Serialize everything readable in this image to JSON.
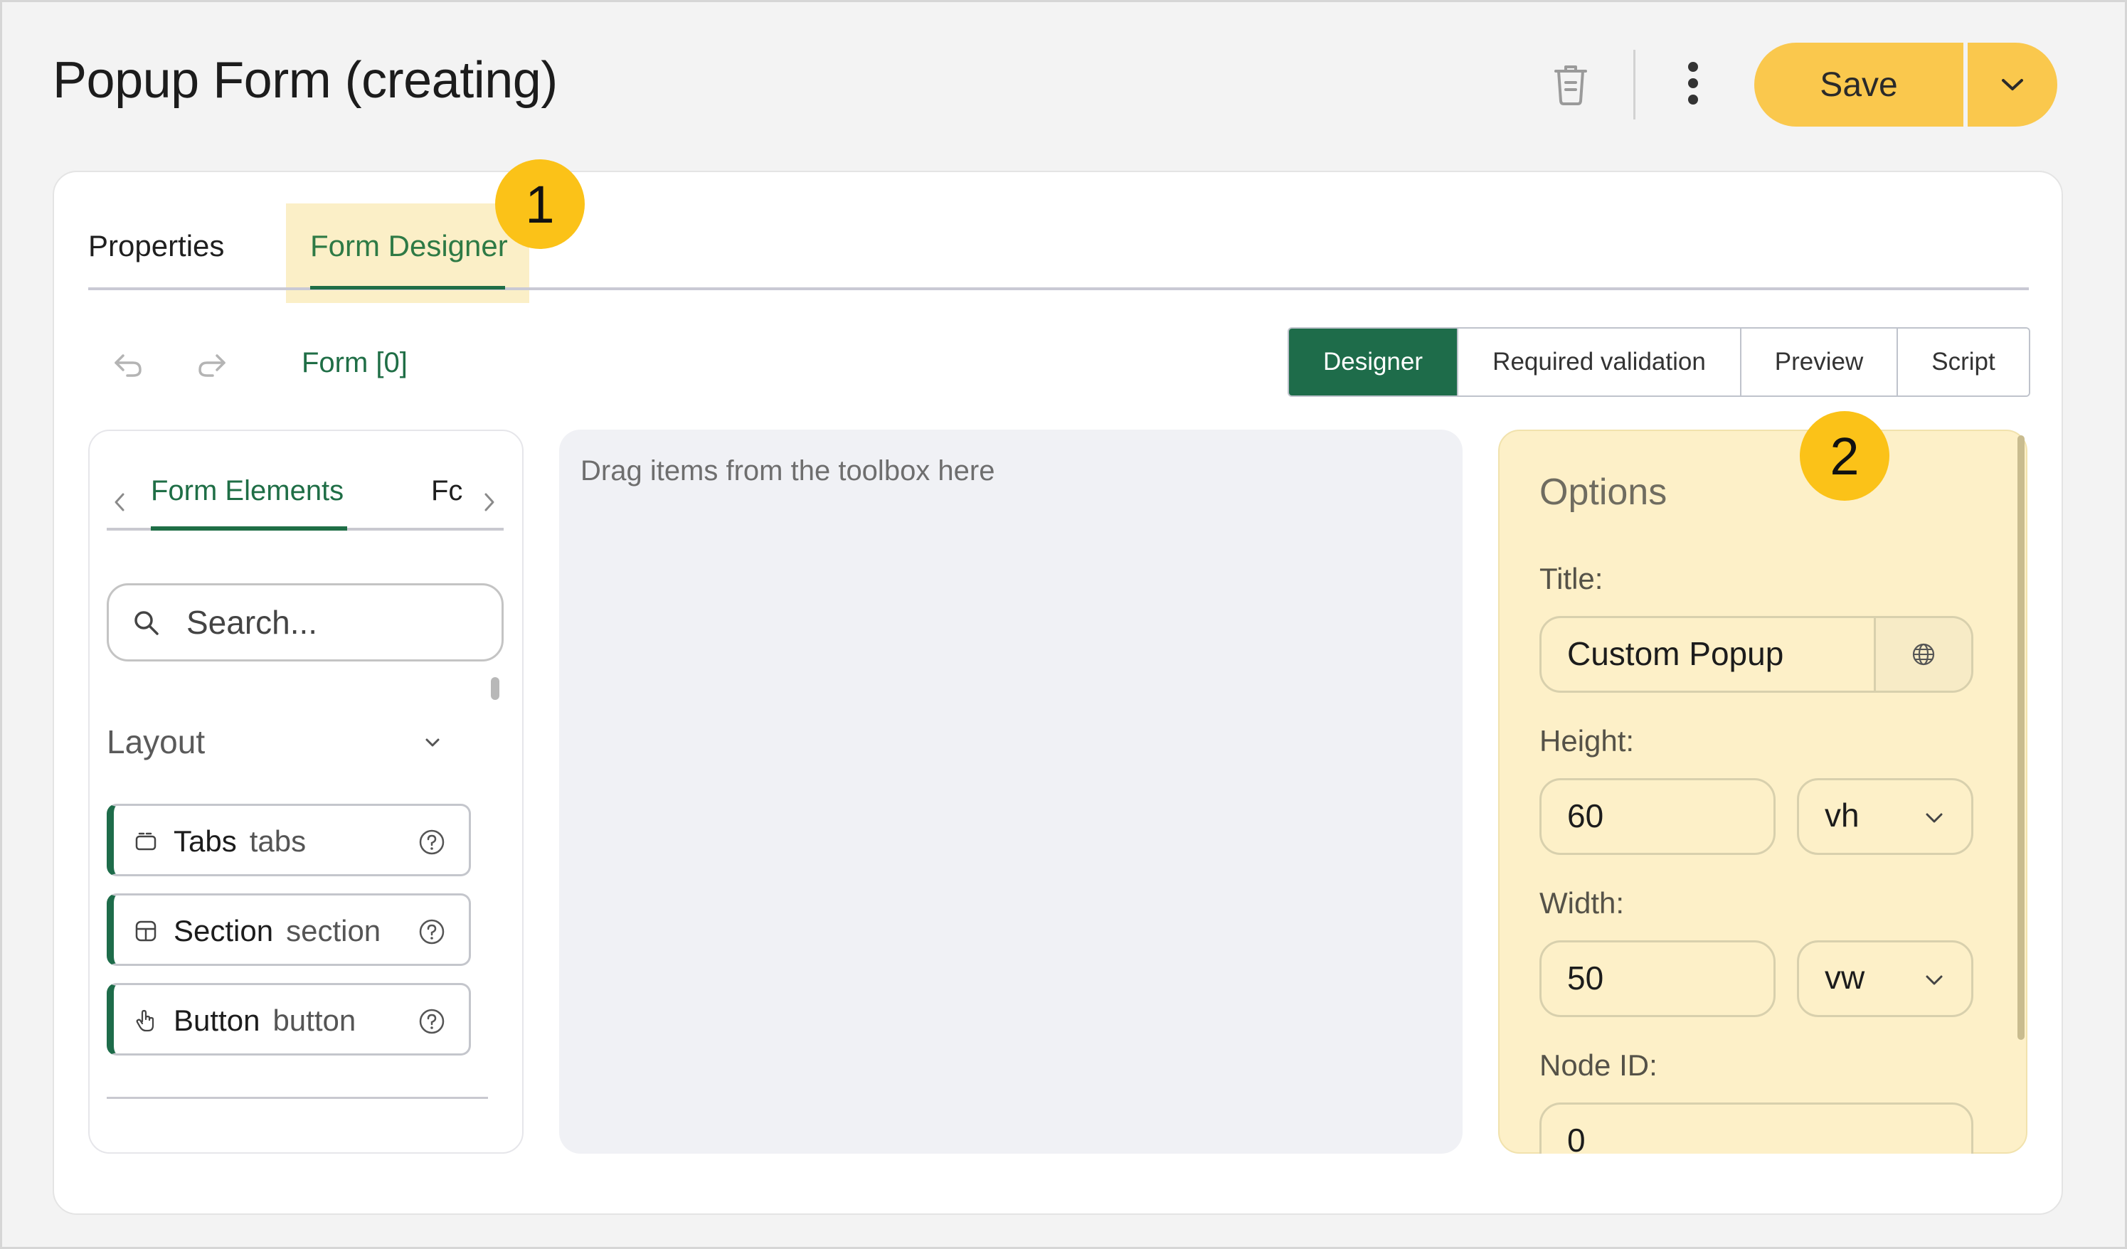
{
  "header": {
    "title": "Popup Form (creating)",
    "save_label": "Save",
    "icons": [
      "trash-icon",
      "more-vertical-icon",
      "chevron-down-icon"
    ]
  },
  "tabs": [
    {
      "label": "Properties",
      "active": false
    },
    {
      "label": "Form Designer",
      "active": true
    }
  ],
  "badges": [
    "1",
    "2"
  ],
  "toolbar": {
    "form_crumb": "Form [0]",
    "modes": [
      {
        "label": "Designer",
        "active": true
      },
      {
        "label": "Required validation",
        "active": false
      },
      {
        "label": "Preview",
        "active": false
      },
      {
        "label": "Script",
        "active": false
      }
    ]
  },
  "toolbox": {
    "tabs": [
      {
        "label": "Form Elements",
        "active": true
      },
      {
        "label": "Fc",
        "active": false
      }
    ],
    "search_placeholder": "Search...",
    "group_label": "Layout",
    "items": [
      {
        "label": "Tabs",
        "type": "tabs",
        "icon": "tabs-icon"
      },
      {
        "label": "Section",
        "type": "section",
        "icon": "section-icon"
      },
      {
        "label": "Button",
        "type": "button",
        "icon": "pointer-hand-icon"
      }
    ]
  },
  "canvas": {
    "hint": "Drag items from the toolbox here"
  },
  "options": {
    "title": "Options",
    "fields": {
      "title_label": "Title:",
      "title_value": "Custom Popup",
      "height_label": "Height:",
      "height_value": "60",
      "height_unit": "vh",
      "width_label": "Width:",
      "width_value": "50",
      "width_unit": "vw",
      "node_label": "Node ID:",
      "node_value": "0"
    }
  },
  "colors": {
    "accent_green": "#1e6c4a",
    "save_yellow": "#fac84d",
    "badge_yellow": "#fbc218",
    "highlight_yellow": "#fdf0c8"
  }
}
